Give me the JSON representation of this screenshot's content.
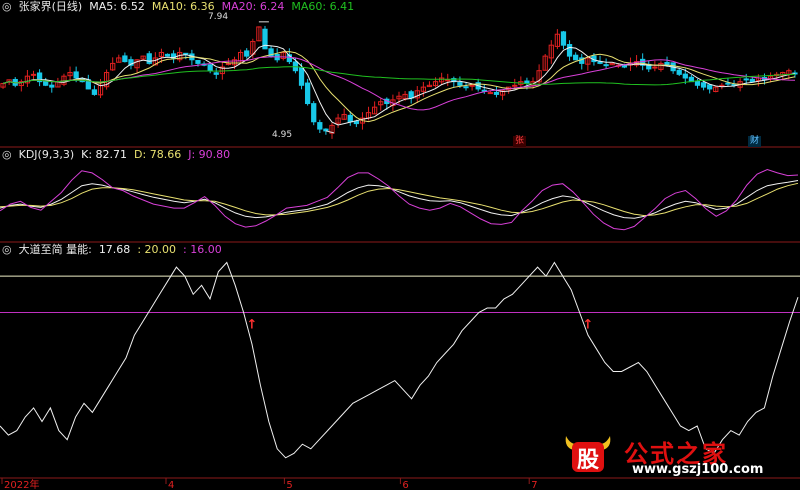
{
  "colors": {
    "background": "#000000",
    "panel_border": "#8c1a1a",
    "up": "#e02020",
    "down": "#18c8e8",
    "ma5": "#f0f0f0",
    "ma10": "#e8e070",
    "ma20": "#d840d8",
    "ma60": "#20c020",
    "kdj_k": "#f0f0f0",
    "kdj_d": "#e8e070",
    "kdj_j": "#d840d8",
    "vol_line": "#f0f0f0",
    "level_20": "#f0f0c8",
    "level_16": "#c030c0",
    "signal": "#ff3030"
  },
  "price_panel": {
    "title": "张家界(日线)",
    "indicators": [
      {
        "label": "MA5: 6.52",
        "color": "#f0f0f0"
      },
      {
        "label": "MA10: 6.36",
        "color": "#e8e070"
      },
      {
        "label": "MA20: 6.24",
        "color": "#d840d8"
      },
      {
        "label": "MA60: 6.41",
        "color": "#20c020"
      }
    ],
    "high_label": "7.94",
    "low_label": "4.95",
    "tags": [
      "张",
      "财"
    ]
  },
  "kdj_panel": {
    "title": "KDJ(9,3,3)",
    "indicators": [
      {
        "label": "K: 82.71",
        "color": "#f0f0f0"
      },
      {
        "label": "D: 78.66",
        "color": "#e8e070"
      },
      {
        "label": "J: 90.80",
        "color": "#d840d8"
      }
    ]
  },
  "vol_panel": {
    "title": "大道至简 量能:",
    "indicators": [
      {
        "label": "17.68",
        "color": "#f0f0f0"
      },
      {
        "label": ": 20.00",
        "color": "#e8e070"
      },
      {
        "label": ": 16.00",
        "color": "#d840d8"
      }
    ]
  },
  "x_axis": {
    "labels": [
      "2022年",
      "4",
      "5",
      "6",
      "7"
    ]
  },
  "watermark": {
    "logo_char": "股",
    "name": "公式之家",
    "url": "www.gszj100.com"
  },
  "chart_data": [
    {
      "type": "candlestick",
      "title": "张家界(日线)",
      "price_range": [
        4.7,
        8.1
      ],
      "annotations": {
        "high": 7.94,
        "low": 4.95
      },
      "ma": {
        "MA5": 6.52,
        "MA10": 6.36,
        "MA20": 6.24,
        "MA60": 6.41
      },
      "x_labels": [
        "2022年",
        "4",
        "5",
        "6",
        "7"
      ],
      "close_series": [
        6.25,
        6.35,
        6.2,
        6.3,
        6.45,
        6.5,
        6.3,
        6.2,
        6.15,
        6.3,
        6.45,
        6.55,
        6.4,
        6.3,
        6.1,
        5.95,
        6.2,
        6.55,
        6.8,
        6.95,
        6.85,
        6.75,
        6.9,
        7.0,
        6.8,
        6.95,
        7.1,
        7.0,
        6.95,
        7.1,
        7.05,
        6.9,
        6.8,
        6.75,
        6.6,
        6.5,
        6.7,
        6.8,
        6.9,
        7.1,
        7.0,
        7.4,
        7.8,
        7.2,
        7.0,
        6.9,
        7.1,
        6.85,
        6.6,
        6.2,
        5.7,
        5.2,
        5.0,
        4.95,
        5.1,
        5.3,
        5.4,
        5.2,
        5.15,
        5.3,
        5.45,
        5.6,
        5.75,
        5.7,
        5.8,
        5.9,
        5.95,
        5.85,
        6.05,
        6.15,
        6.2,
        6.3,
        6.4,
        6.35,
        6.3,
        6.2,
        6.15,
        6.2,
        6.1,
        6.05,
        6.0,
        5.95,
        6.05,
        6.15,
        6.2,
        6.3,
        6.25,
        6.3,
        6.6,
        7.0,
        7.3,
        7.6,
        7.3,
        7.0,
        6.9,
        6.8,
        6.95,
        6.85,
        6.8,
        6.75,
        6.8,
        6.75,
        6.7,
        6.8,
        6.85,
        6.75,
        6.65,
        6.7,
        6.8,
        6.75,
        6.6,
        6.5,
        6.4,
        6.3,
        6.2,
        6.15,
        6.1,
        6.15,
        6.2,
        6.25,
        6.2,
        6.3,
        6.35,
        6.3,
        6.4,
        6.35,
        6.45,
        6.5,
        6.55,
        6.6,
        6.52
      ]
    },
    {
      "type": "line",
      "title": "KDJ(9,3,3)",
      "ylim": [
        -5,
        110
      ],
      "series": [
        {
          "name": "K",
          "value": 82.71,
          "values": [
            42,
            46,
            48,
            45,
            43,
            48,
            55,
            65,
            75,
            78,
            76,
            72,
            70,
            66,
            62,
            58,
            55,
            52,
            50,
            52,
            55,
            50,
            42,
            35,
            30,
            28,
            29,
            32,
            36,
            38,
            40,
            44,
            48,
            56,
            65,
            72,
            76,
            75,
            72,
            66,
            60,
            56,
            53,
            52,
            53,
            50,
            45,
            40,
            35,
            32,
            31,
            36,
            42,
            50,
            56,
            60,
            58,
            52,
            45,
            38,
            32,
            28,
            27,
            30,
            35,
            42,
            48,
            52,
            50,
            45,
            40,
            42,
            48,
            58,
            68,
            75,
            78,
            80,
            82.71
          ]
        },
        {
          "name": "D",
          "value": 78.66,
          "values": [
            44,
            45,
            46,
            46,
            45,
            46,
            50,
            56,
            64,
            70,
            72,
            72,
            71,
            69,
            66,
            63,
            60,
            57,
            54,
            53,
            53,
            52,
            48,
            43,
            38,
            34,
            32,
            32,
            33,
            35,
            37,
            40,
            43,
            48,
            54,
            61,
            67,
            70,
            71,
            69,
            66,
            63,
            60,
            57,
            55,
            53,
            50,
            47,
            43,
            39,
            36,
            35,
            37,
            41,
            46,
            51,
            54,
            53,
            51,
            47,
            42,
            37,
            33,
            31,
            32,
            35,
            40,
            44,
            47,
            47,
            45,
            44,
            45,
            49,
            56,
            63,
            70,
            75,
            78.66
          ]
        },
        {
          "name": "J",
          "value": 90.8,
          "values": [
            38,
            48,
            52,
            43,
            39,
            52,
            65,
            83,
            97,
            94,
            84,
            72,
            68,
            60,
            54,
            48,
            45,
            42,
            42,
            50,
            59,
            46,
            30,
            19,
            14,
            16,
            23,
            32,
            42,
            44,
            46,
            52,
            58,
            72,
            87,
            94,
            94,
            85,
            74,
            60,
            48,
            42,
            39,
            42,
            49,
            44,
            35,
            26,
            19,
            18,
            21,
            38,
            52,
            68,
            76,
            78,
            66,
            50,
            33,
            20,
            12,
            10,
            15,
            28,
            41,
            56,
            64,
            68,
            56,
            41,
            30,
            38,
            54,
            76,
            92,
            99,
            94,
            90,
            90.8
          ]
        }
      ]
    },
    {
      "type": "line",
      "title": "大道至简 量能",
      "ylim": [
        -2,
        22
      ],
      "reference_lines": [
        20,
        16
      ],
      "series": [
        {
          "name": "量能",
          "value": 17.68,
          "values": [
            3.5,
            2.5,
            3.0,
            4.5,
            5.5,
            4.0,
            5.5,
            3.0,
            2.0,
            4.5,
            6.0,
            5.0,
            6.5,
            8.0,
            9.5,
            11.0,
            13.5,
            15.0,
            16.5,
            18.0,
            19.5,
            21.0,
            20.0,
            18.0,
            19.0,
            17.5,
            20.5,
            21.5,
            19.0,
            16.0,
            12.5,
            8.0,
            4.0,
            1.0,
            0.0,
            0.5,
            1.5,
            1.0,
            2.0,
            3.0,
            4.0,
            5.0,
            6.0,
            6.5,
            7.0,
            7.5,
            8.0,
            8.5,
            7.5,
            6.5,
            8.0,
            9.0,
            10.5,
            11.5,
            12.5,
            14.0,
            15.0,
            16.0,
            16.5,
            16.5,
            17.5,
            18.0,
            19.0,
            20.0,
            21.0,
            20.0,
            21.5,
            20.0,
            18.5,
            16.0,
            13.5,
            12.0,
            10.5,
            9.5,
            9.5,
            10.0,
            10.5,
            9.5,
            8.0,
            6.5,
            5.0,
            3.5,
            3.0,
            3.5,
            1.0,
            0.5,
            2.0,
            3.0,
            2.5,
            4.0,
            5.0,
            5.5,
            9.0,
            12.0,
            15.0,
            17.68
          ]
        }
      ],
      "signals": [
        {
          "value": 16.0,
          "label": "↑"
        },
        {
          "value": 16.0,
          "label": "↑"
        }
      ]
    }
  ]
}
